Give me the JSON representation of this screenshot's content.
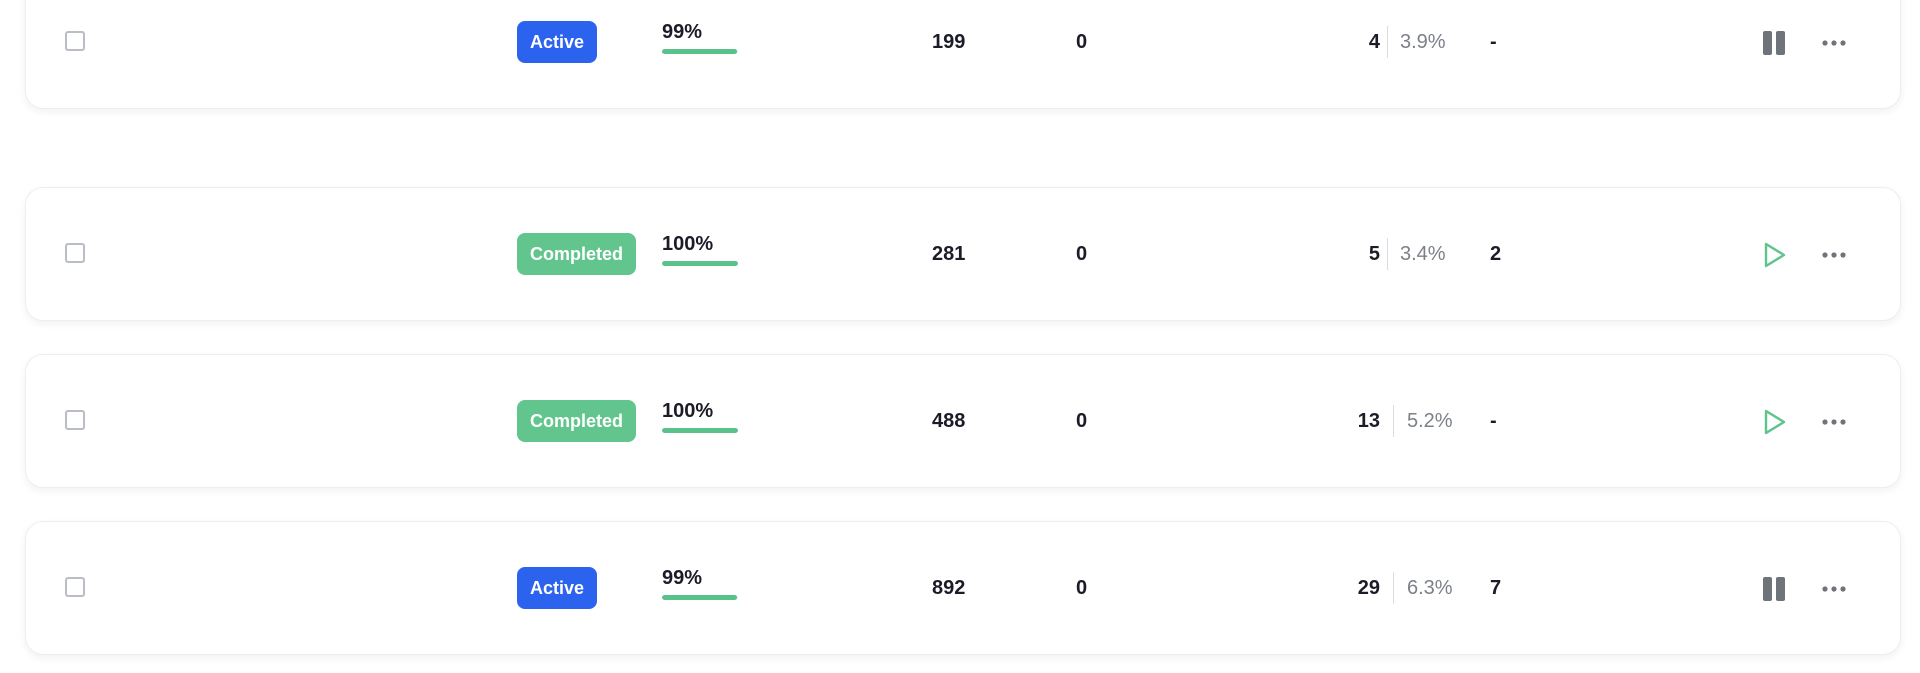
{
  "rows": [
    {
      "status": "Active",
      "status_type": "active",
      "progress_label": "99%",
      "progress_value": 0.99,
      "sent": "199",
      "zero": "0",
      "count": "4",
      "percent": "3.9%",
      "extra": "-",
      "action": "pause-icon"
    },
    {
      "status": "Completed",
      "status_type": "completed",
      "progress_label": "100%",
      "progress_value": 1.0,
      "sent": "281",
      "zero": "0",
      "count": "5",
      "percent": "3.4%",
      "extra": "2",
      "action": "play-icon"
    },
    {
      "status": "Completed",
      "status_type": "completed",
      "progress_label": "100%",
      "progress_value": 1.0,
      "sent": "488",
      "zero": "0",
      "count": "13",
      "percent": "5.2%",
      "extra": "-",
      "action": "play-icon"
    },
    {
      "status": "Active",
      "status_type": "active",
      "progress_label": "99%",
      "progress_value": 0.99,
      "sent": "892",
      "zero": "0",
      "count": "29",
      "percent": "6.3%",
      "extra": "7",
      "action": "pause-icon"
    }
  ],
  "colors": {
    "active": "#2c63ee",
    "completed": "#62c58d",
    "progress": "#58c28a",
    "pause_icon": "#6f737a",
    "play_icon": "#5fc48c"
  }
}
